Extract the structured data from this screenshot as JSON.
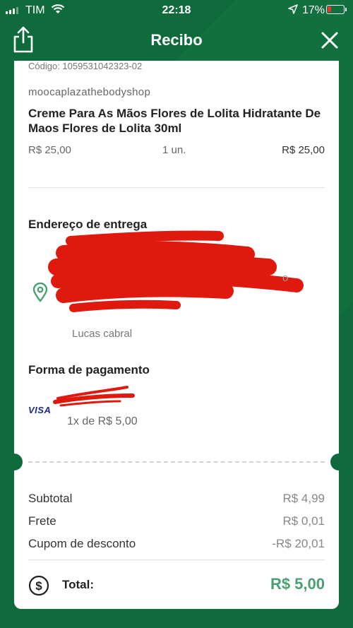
{
  "status_bar": {
    "carrier": "TIM",
    "time": "22:18",
    "battery_percent": "17%"
  },
  "nav": {
    "title": "Recibo"
  },
  "order": {
    "code_line": "Código: 1059531042323-02",
    "store": "moocaplazathebodyshop",
    "product_name": "Creme Para As Mãos Flores de Lolita Hidratante De Maos Flores de Lolita 30ml",
    "unit_price": "R$ 25,00",
    "quantity": "1 un.",
    "item_total": "R$ 25,00"
  },
  "delivery": {
    "title": "Endereço de entrega",
    "recipient": "Lucas cabral"
  },
  "payment": {
    "title": "Forma de pagamento",
    "card_brand": "VISA",
    "installments": "1x de R$ 5,00"
  },
  "summary": {
    "subtotal_label": "Subtotal",
    "subtotal_value": "R$ 4,99",
    "shipping_label": "Frete",
    "shipping_value": "R$ 0,01",
    "coupon_label": "Cupom de desconto",
    "coupon_value": "-R$ 20,01",
    "total_label": "Total:",
    "total_value": "R$ 5,00"
  },
  "colors": {
    "brand_green": "#0f6b3c",
    "total_green": "#4aa070",
    "redaction_red": "#e0190f",
    "visa_blue": "#1a2a8c"
  }
}
